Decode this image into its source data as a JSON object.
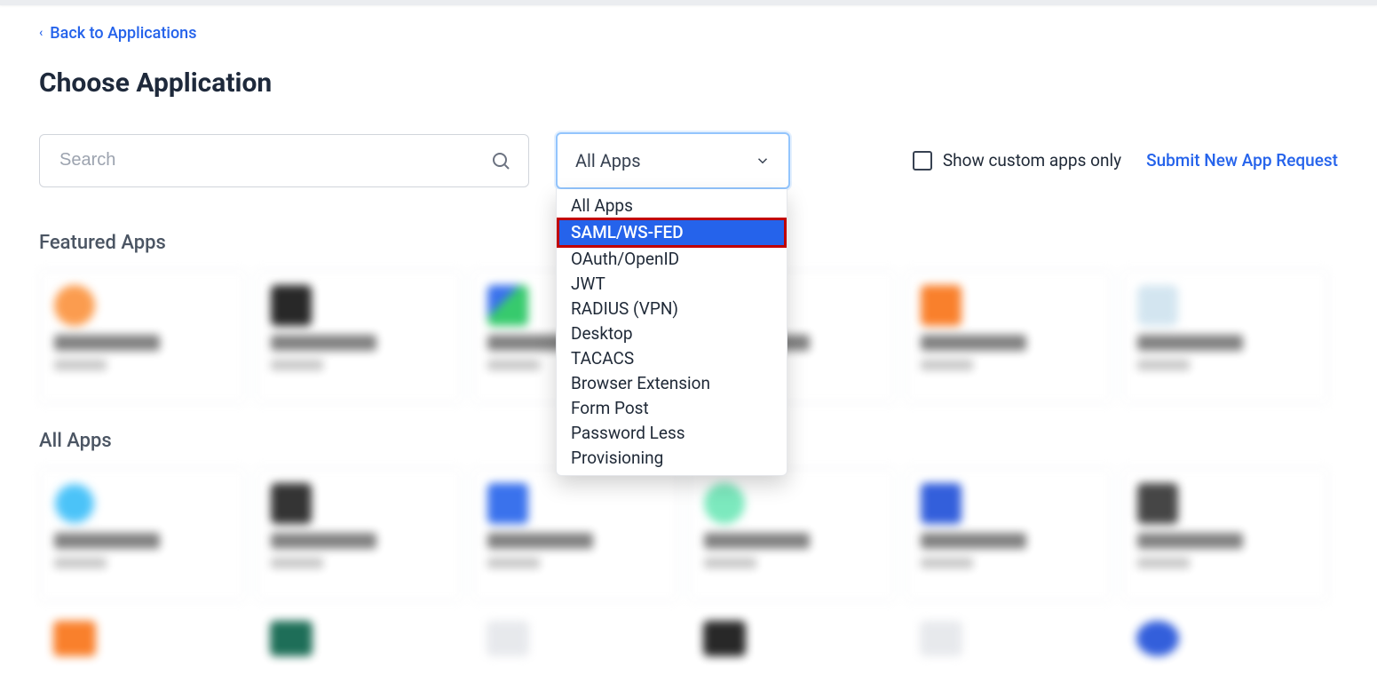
{
  "nav": {
    "back_label": "Back to Applications"
  },
  "title": "Choose Application",
  "search": {
    "placeholder": "Search"
  },
  "filter": {
    "selected": "All Apps",
    "options": [
      "All Apps",
      "SAML/WS-FED",
      "OAuth/OpenID",
      "JWT",
      "RADIUS (VPN)",
      "Desktop",
      "TACACS",
      "Browser Extension",
      "Form Post",
      "Password Less",
      "Provisioning"
    ],
    "highlight_index": 1
  },
  "controls": {
    "custom_only_label": "Show custom apps only",
    "submit_label": "Submit New App Request"
  },
  "sections": {
    "featured_label": "Featured Apps",
    "all_label": "All Apps"
  }
}
